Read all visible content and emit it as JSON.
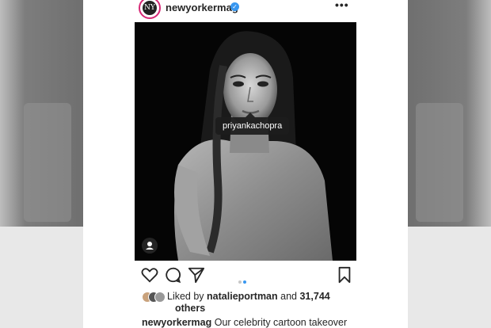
{
  "post": {
    "username": "newyorkermag",
    "verified": true,
    "tagged_user": "priyankachopra",
    "avatar_monogram": "NY"
  },
  "likes": {
    "prefix": "Liked by",
    "liker": "natalieportman",
    "joiner": "and",
    "count": "31,744",
    "suffix": "others"
  },
  "caption": {
    "username": "newyorkermag",
    "text": "Our celebrity cartoon takeover"
  },
  "carousel": {
    "total": 2,
    "active_index": 1
  },
  "colors": {
    "accent": "#3897f0",
    "ring": "#d62976",
    "text": "#262626"
  }
}
